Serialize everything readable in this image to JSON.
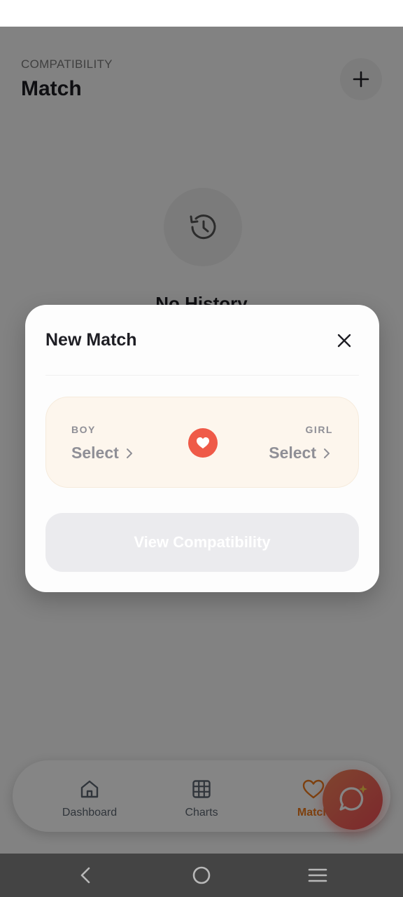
{
  "header": {
    "eyebrow": "COMPATIBILITY",
    "title": "Match",
    "add_icon": "plus-icon"
  },
  "empty_state": {
    "icon": "history-icon",
    "title": "No History"
  },
  "modal": {
    "title": "New Match",
    "close_icon": "close-icon",
    "boy": {
      "label": "BOY",
      "value": "Select"
    },
    "girl": {
      "label": "GIRL",
      "value": "Select"
    },
    "center_icon": "heart-icon",
    "cta_label": "View Compatibility"
  },
  "bottom_nav": {
    "items": [
      {
        "label": "Dashboard",
        "icon": "home-icon",
        "active": false
      },
      {
        "label": "Charts",
        "icon": "grid-icon",
        "active": false
      },
      {
        "label": "Match",
        "icon": "heart-icon",
        "active": true
      }
    ]
  },
  "fab": {
    "icon": "chat-sparkle-icon"
  },
  "colors": {
    "accent": "#ef7b1c",
    "fab_start": "#f5855a",
    "fab_end": "#ee4c56",
    "heart_badge": "#ef5a48",
    "card_bg": "#fdf6ed"
  }
}
